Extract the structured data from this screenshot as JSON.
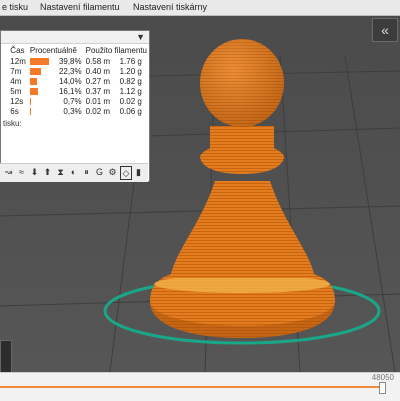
{
  "tabs": [
    "e tisku",
    "Nastavení filamentu",
    "Nastavení tiskárny"
  ],
  "sidebar_toggle_icon": "double-chevron-left-icon",
  "legend": {
    "headers": {
      "time": "Čas",
      "percent": "Procentuálně",
      "filament": "Použito filamentu"
    },
    "rows": [
      {
        "time": "12m",
        "percent": "39,8%",
        "share": 0.398,
        "length": "0.58 m",
        "weight": "1.76 g",
        "color": "#f47a2a"
      },
      {
        "time": "7m",
        "percent": "22,3%",
        "share": 0.223,
        "length": "0.40 m",
        "weight": "1.20 g",
        "color": "#f47a2a"
      },
      {
        "time": "4m",
        "percent": "14,0%",
        "share": 0.14,
        "length": "0.27 m",
        "weight": "0.82 g",
        "color": "#f47a2a"
      },
      {
        "time": "5m",
        "percent": "16,1%",
        "share": 0.161,
        "length": "0.37 m",
        "weight": "1.12 g",
        "color": "#f47a2a"
      },
      {
        "time": "12s",
        "percent": "0,7%",
        "share": 0.007,
        "length": "0.01 m",
        "weight": "0.02 g",
        "color": "#f47a2a"
      },
      {
        "time": "6s",
        "percent": "0,3%",
        "share": 0.003,
        "length": "0.02 m",
        "weight": "0.06 g",
        "color": "#f47a2a"
      }
    ],
    "footer_label": "tisku:",
    "dropdown_icon": "dropdown-arrow-icon"
  },
  "view_toolbar": [
    "travel-icon",
    "wipe-icon",
    "retractions-icon",
    "deretractions-icon",
    "seams-icon",
    "color-changes-icon",
    "pause-icon",
    "custom-gcode-icon",
    "cog-icon",
    "shells-icon",
    "tool-marker-icon"
  ],
  "layer_slider": {
    "value": "48050",
    "position": 1.0
  },
  "colors": {
    "model": "#e07b1e",
    "bed_ring": "#1aa688",
    "accent": "#ee8a3a"
  }
}
